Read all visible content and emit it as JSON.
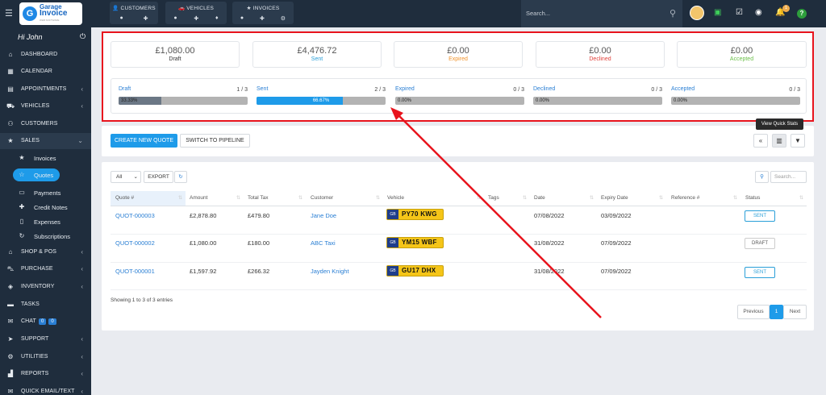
{
  "app": {
    "logo_line1": "Garage",
    "logo_line2": "Invoice",
    "logo_line3": "WEB SOFTWARE",
    "greeting": "Hi John"
  },
  "topnav": {
    "customers": "CUSTOMERS",
    "vehicles": "VEHICLES",
    "invoices": "INVOICES",
    "search_placeholder": "Search...",
    "notification_count": "1"
  },
  "sidebar": {
    "items": [
      {
        "label": "DASHBOARD",
        "icon": "home-icon"
      },
      {
        "label": "CALENDAR",
        "icon": "calendar-icon"
      },
      {
        "label": "APPOINTMENTS",
        "icon": "calendar-check-icon"
      },
      {
        "label": "VEHICLES",
        "icon": "car-icon"
      },
      {
        "label": "CUSTOMERS",
        "icon": "user-icon"
      },
      {
        "label": "SALES",
        "icon": "star-icon"
      }
    ],
    "sales_sub": [
      {
        "label": "Invoices",
        "icon": "star-icon"
      },
      {
        "label": "Quotes",
        "icon": "star-outline-icon"
      },
      {
        "label": "Payments",
        "icon": "credit-card-icon"
      },
      {
        "label": "Credit Notes",
        "icon": "plus-icon"
      },
      {
        "label": "Expenses",
        "icon": "file-icon"
      },
      {
        "label": "Subscriptions",
        "icon": "refresh-icon"
      }
    ],
    "items2": [
      {
        "label": "SHOP & POS",
        "icon": "shop-icon"
      },
      {
        "label": "PURCHASE",
        "icon": "cart-icon"
      },
      {
        "label": "INVENTORY",
        "icon": "box-icon"
      },
      {
        "label": "TASKS",
        "icon": "tasks-icon"
      },
      {
        "label": "CHAT",
        "icon": "chat-icon"
      },
      {
        "label": "SUPPORT",
        "icon": "send-icon"
      },
      {
        "label": "UTILITIES",
        "icon": "cogs-icon"
      },
      {
        "label": "REPORTS",
        "icon": "chart-icon"
      },
      {
        "label": "QUICK EMAIL/TEXT",
        "icon": "envelope-icon"
      }
    ],
    "chat_badge1": "0",
    "chat_badge2": "0"
  },
  "stats": [
    {
      "amount": "£1,080.00",
      "label": "Draft",
      "color": "#333333"
    },
    {
      "amount": "£4,476.72",
      "label": "Sent",
      "color": "#2a9fd8"
    },
    {
      "amount": "£0.00",
      "label": "Expired",
      "color": "#f0932b"
    },
    {
      "amount": "£0.00",
      "label": "Declined",
      "color": "#e0413a"
    },
    {
      "amount": "£0.00",
      "label": "Accepted",
      "color": "#6cc04a"
    }
  ],
  "progress": [
    {
      "name": "Draft",
      "count": "1 / 3",
      "pct": "33.33%",
      "fraction": 0.3333,
      "color": "#2a7fd4",
      "fill": "#6b7785"
    },
    {
      "name": "Sent",
      "count": "2 / 3",
      "pct": "66.67%",
      "fraction": 0.6667,
      "color": "#2a7fd4",
      "fill": "#1e9be9"
    },
    {
      "name": "Expired",
      "count": "0 / 3",
      "pct": "0.00%",
      "fraction": 0,
      "color": "#2a7fd4",
      "fill": "#1e9be9"
    },
    {
      "name": "Declined",
      "count": "0 / 3",
      "pct": "0.00%",
      "fraction": 0,
      "color": "#2a7fd4",
      "fill": "#1e9be9"
    },
    {
      "name": "Accepted",
      "count": "0 / 3",
      "pct": "0.00%",
      "fraction": 0,
      "color": "#2a7fd4",
      "fill": "#1e9be9"
    }
  ],
  "toolbar": {
    "create_label": "CREATE NEW QUOTE",
    "pipeline_label": "SWITCH TO PIPELINE",
    "tooltip": "View Quick Stats"
  },
  "table": {
    "filter_value": "All",
    "export_label": "EXPORT",
    "search_placeholder": "Search...",
    "columns": [
      "Quote #",
      "Amount",
      "Total Tax",
      "Customer",
      "Vehicle",
      "Tags",
      "Date",
      "Expiry Date",
      "Reference #",
      "Status"
    ],
    "rows": [
      {
        "quote": "QUOT-000003",
        "amount": "£2,878.80",
        "tax": "£479.80",
        "customer": "Jane Doe",
        "plate_cc": "GB",
        "plate": "PY70 KWG",
        "tags": "",
        "date": "07/08/2022",
        "expiry": "03/09/2022",
        "ref": "",
        "status": "SENT",
        "status_color": "#2a9fd8"
      },
      {
        "quote": "QUOT-000002",
        "amount": "£1,080.00",
        "tax": "£180.00",
        "customer": "ABC Taxi",
        "plate_cc": "GB",
        "plate": "YM15 WBF",
        "tags": "",
        "date": "31/08/2022",
        "expiry": "07/09/2022",
        "ref": "",
        "status": "DRAFT",
        "status_color": "#555555"
      },
      {
        "quote": "QUOT-000001",
        "amount": "£1,597.92",
        "tax": "£266.32",
        "customer": "Jayden Knight",
        "plate_cc": "GB",
        "plate": "GU17 DHX",
        "tags": "",
        "date": "31/08/2022",
        "expiry": "07/09/2022",
        "ref": "",
        "status": "SENT",
        "status_color": "#2a9fd8"
      }
    ],
    "showing": "Showing 1 to 3 of 3 entries",
    "pagination": {
      "previous": "Previous",
      "current": "1",
      "next": "Next"
    }
  },
  "colors": {
    "accent": "#1e9be9",
    "sidebar": "#1f2d3d",
    "highlight": "#e8141d"
  }
}
